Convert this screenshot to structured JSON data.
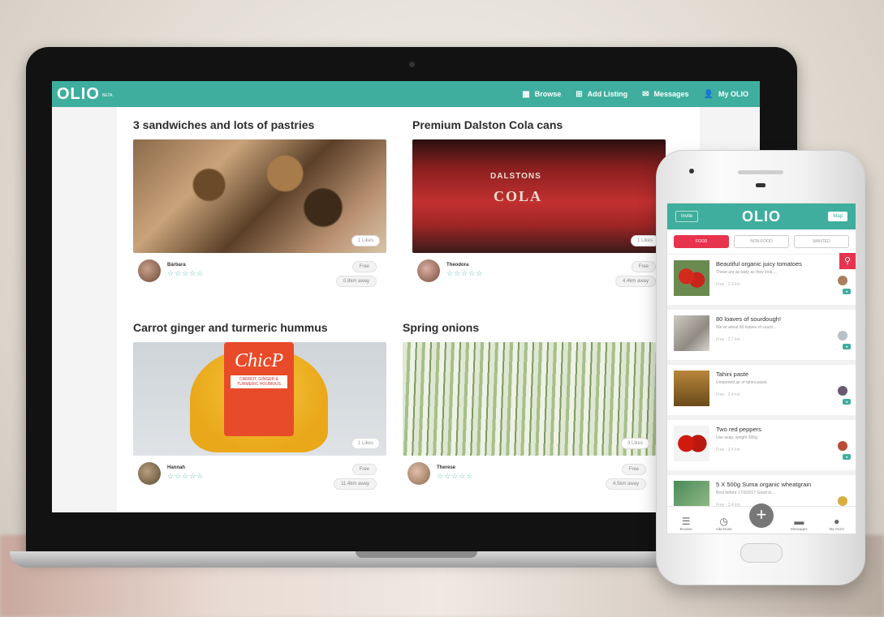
{
  "web": {
    "logo": "OLIO",
    "beta": "BETA",
    "nav": [
      {
        "icon": "▦",
        "label": "Browse"
      },
      {
        "icon": "⊞",
        "label": "Add Listing"
      },
      {
        "icon": "✉",
        "label": "Messages"
      },
      {
        "icon": "👤",
        "label": "My OLIO"
      }
    ],
    "listings": [
      {
        "title": "3 sandwiches and lots of pastries",
        "likes": "1 Likes",
        "user": "Bárbara",
        "stars": "☆☆☆☆☆",
        "price": "Free",
        "distance": "0.8km away"
      },
      {
        "title": "Premium Dalston Cola cans",
        "likes": "1 Likes",
        "user": "Theodora",
        "stars": "☆☆☆☆☆",
        "price": "Free",
        "distance": "4.4km away",
        "brand": "DALSTONS",
        "brand_sub": "COLA"
      },
      {
        "title": "Carrot ginger and turmeric hummus",
        "likes": "1 Likes",
        "user": "Hannah",
        "stars": "☆☆☆☆☆",
        "price": "Free",
        "distance": "11.4km away",
        "label_title": "ChicP",
        "label_sub": "CARROT, GINGER & TURMERIC HOUMOUS"
      },
      {
        "title": "Spring onions",
        "likes": "3 Likes",
        "user": "Therese",
        "stars": "☆☆☆☆☆",
        "price": "Free",
        "distance": "4.5km away"
      }
    ]
  },
  "app": {
    "invite": "Invite",
    "title": "OLIO",
    "map": "Map",
    "tabs": [
      "FOOD",
      "NON-FOOD",
      "WANTED"
    ],
    "items": [
      {
        "title": "Beautiful organic juicy tomatoes",
        "desc": "These are as tasty as they look,...",
        "meta": "Free  ·  2.3 km"
      },
      {
        "title": "80 loaves of sourdough!",
        "desc": "We've about 80 loaves of sourd...",
        "meta": "Free  ·  2.7 km"
      },
      {
        "title": "Tahini paste",
        "desc": "Unopened jar of tahini paste.",
        "meta": "Free  ·  2.4 km"
      },
      {
        "title": "Two red peppers",
        "desc": "Use asap, weight 300g",
        "meta": "Free  ·  2.4 km"
      },
      {
        "title": "5 X 500g Suma organic wheatgrain",
        "desc": "Best before 17/3/2017 Good to...",
        "meta": "Free  ·  2.4 km"
      }
    ],
    "bottom_nav": [
      "Browse",
      "Add Done",
      "",
      "Messages",
      "My OLIO"
    ]
  },
  "colors": {
    "teal": "#3fae9e",
    "pink": "#e8334f"
  }
}
